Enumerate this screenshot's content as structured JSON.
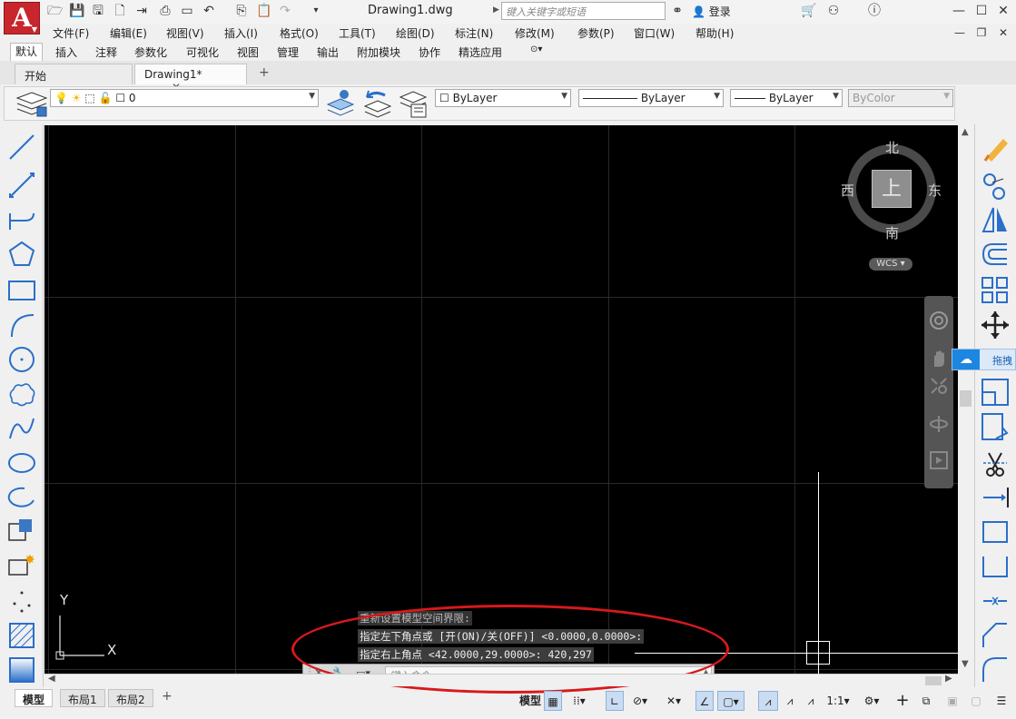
{
  "title_bar": {
    "app_logo": "A",
    "document_title": "Drawing1.dwg",
    "search_placeholder": "键入关键字或短语",
    "login_label": "登录"
  },
  "menu": {
    "items": [
      "文件(F)",
      "编辑(E)",
      "视图(V)",
      "插入(I)",
      "格式(O)",
      "工具(T)",
      "绘图(D)",
      "标注(N)",
      "修改(M)",
      "参数(P)",
      "窗口(W)",
      "帮助(H)"
    ]
  },
  "ribbon_tabs": {
    "items": [
      "默认",
      "插入",
      "注释",
      "参数化",
      "可视化",
      "视图",
      "管理",
      "输出",
      "附加模块",
      "协作",
      "精选应用"
    ],
    "active_index": 0
  },
  "file_tabs": {
    "items": [
      "开始",
      "Drawing1*"
    ],
    "active_index": 1,
    "close_glyph": "✕",
    "add_glyph": "+"
  },
  "properties": {
    "layer_value": "0",
    "color": "ByLayer",
    "linetype": "ByLayer",
    "lineweight": "ByLayer",
    "plotstyle": "ByColor"
  },
  "viewcube": {
    "north": "北",
    "south": "南",
    "east": "东",
    "west": "西",
    "face": "上",
    "wcs": "WCS"
  },
  "ucs": {
    "y_label": "Y",
    "x_label": "X"
  },
  "command_history": [
    "重新设置模型空间界限:",
    "指定左下角点或 [开(ON)/关(OFF)] <0.0000,0.0000>:",
    "指定右上角点 <42.0000,29.0000>: 420,297"
  ],
  "command_input": {
    "placeholder": "键入命令"
  },
  "layout_tabs": {
    "items": [
      "模型",
      "布局1",
      "布局2"
    ],
    "active_index": 0,
    "add_glyph": "+"
  },
  "status_bar": {
    "model_label": "模型",
    "scale_label": "1:1"
  },
  "float_panel": {
    "label": "拖拽"
  },
  "colors": {
    "canvas_bg": "#000000",
    "annotation_red": "#d7191c",
    "app_red": "#c8262c"
  }
}
